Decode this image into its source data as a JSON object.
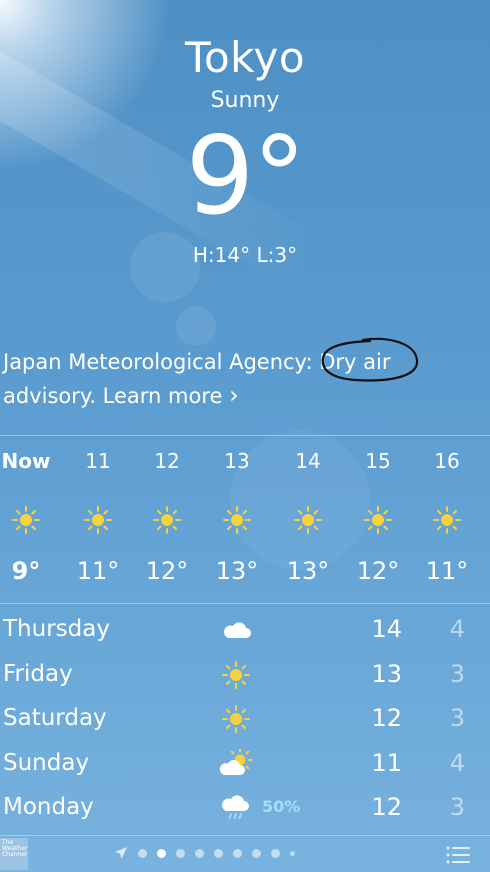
{
  "header": {
    "city": "Tokyo",
    "condition": "Sunny",
    "temperature": "9°",
    "hi_lo": "H:14°  L:3°"
  },
  "advisory": {
    "text_prefix": "Japan Meteorological Agency: ",
    "highlight": "Dry air",
    "text_suffix": " advisory. Learn more ",
    "chevron": "›"
  },
  "hourly": [
    {
      "label": "Now",
      "icon": "sun-icon",
      "temp": "9°"
    },
    {
      "label": "11",
      "icon": "sun-icon",
      "temp": "11°"
    },
    {
      "label": "12",
      "icon": "sun-icon",
      "temp": "12°"
    },
    {
      "label": "13",
      "icon": "sun-icon",
      "temp": "13°"
    },
    {
      "label": "14",
      "icon": "sun-icon",
      "temp": "13°"
    },
    {
      "label": "15",
      "icon": "sun-icon",
      "temp": "12°"
    },
    {
      "label": "16",
      "icon": "sun-icon",
      "temp": "11°"
    }
  ],
  "daily": [
    {
      "day": "Thursday",
      "icon": "cloud-icon",
      "precip": "",
      "high": "14",
      "low": "4"
    },
    {
      "day": "Friday",
      "icon": "sun-icon",
      "precip": "",
      "high": "13",
      "low": "3"
    },
    {
      "day": "Saturday",
      "icon": "sun-icon",
      "precip": "",
      "high": "12",
      "low": "3"
    },
    {
      "day": "Sunday",
      "icon": "partly-cloudy-icon",
      "precip": "",
      "high": "11",
      "low": "4"
    },
    {
      "day": "Monday",
      "icon": "rain-cloud-icon",
      "precip": "50%",
      "high": "12",
      "low": "3"
    }
  ],
  "footer": {
    "logo_text": "The Weather Channel",
    "page_count": 9,
    "active_page": 1
  },
  "colors": {
    "sun": "#f7d23e",
    "precip": "#a9dcf7",
    "annotation": "#111111"
  }
}
